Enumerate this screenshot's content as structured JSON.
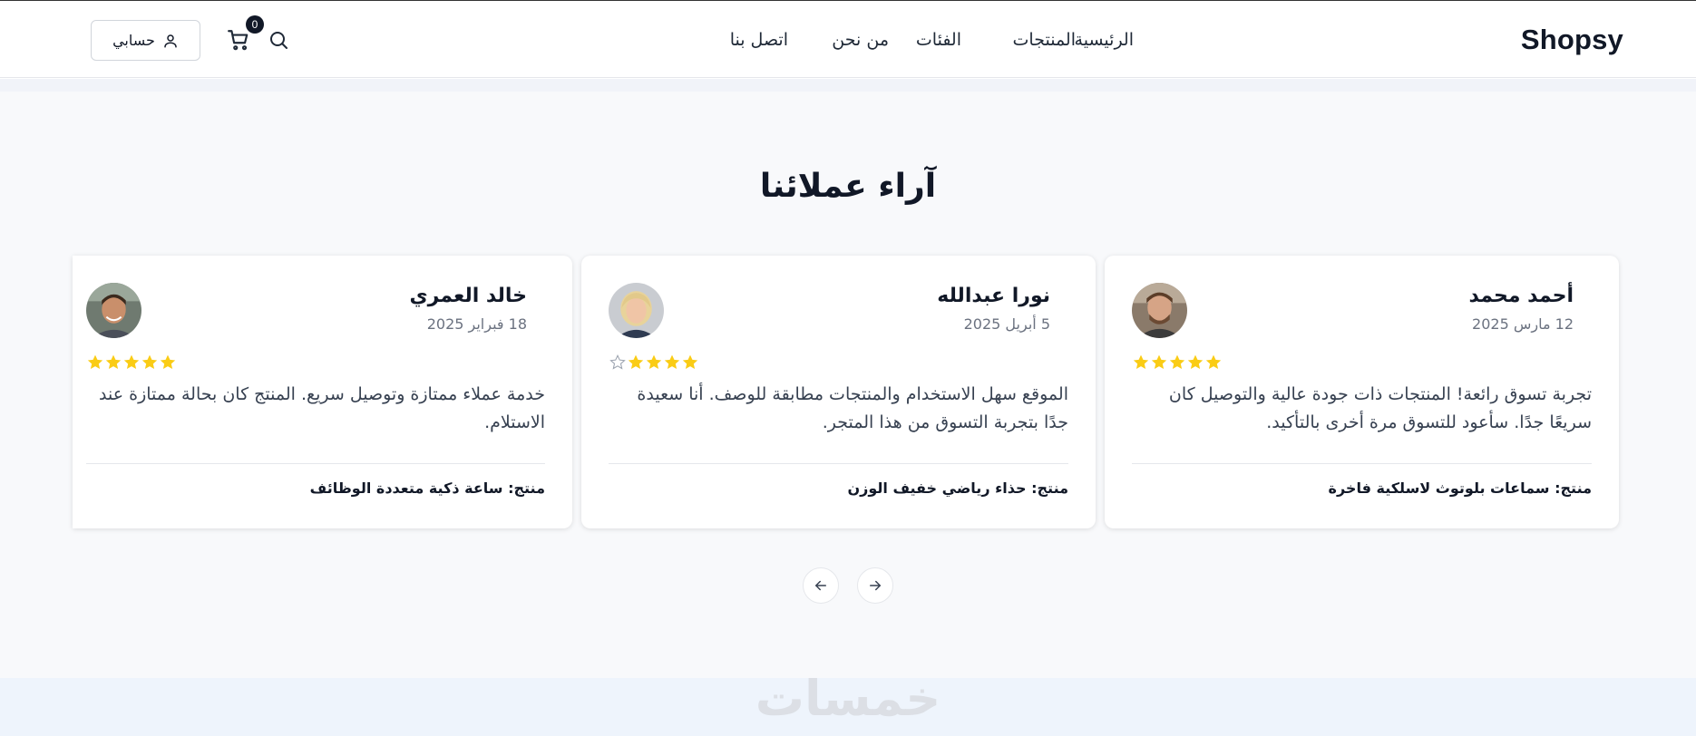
{
  "header": {
    "logo": "Shopsy",
    "nav": [
      "الرئيسية",
      "المنتجات",
      "الفئات",
      "من نحن",
      "اتصل بنا"
    ],
    "account_label": "حسابي",
    "cart_count": "0"
  },
  "testimonials": {
    "title": "آراء عملائنا",
    "reviews": [
      {
        "name": "أحمد محمد",
        "date": "12 مارس 2025",
        "rating": 5,
        "text": "تجربة تسوق رائعة! المنتجات ذات جودة عالية والتوصيل كان سريعًا جدًا. سأعود للتسوق مرة أخرى بالتأكيد.",
        "product": "منتج: سماعات بلوتوث لاسلكية فاخرة"
      },
      {
        "name": "نورا عبدالله",
        "date": "5 أبريل 2025",
        "rating": 4,
        "text": "الموقع سهل الاستخدام والمنتجات مطابقة للوصف. أنا سعيدة جدًا بتجربة التسوق من هذا المتجر.",
        "product": "منتج: حذاء رياضي خفيف الوزن"
      },
      {
        "name": "خالد العمري",
        "date": "18 فبراير 2025",
        "rating": 5,
        "text": "خدمة عملاء ممتازة وتوصيل سريع. المنتج كان بحالة ممتازة عند الاستلام.",
        "product": "منتج: ساعة ذكية متعددة الوظائف"
      }
    ]
  },
  "watermark": "خمسات",
  "colors": {
    "star_filled": "#facc15",
    "star_empty": "#9ca3af",
    "section_bg": "#f8f9fb",
    "footer_bg": "#eef4fc"
  }
}
